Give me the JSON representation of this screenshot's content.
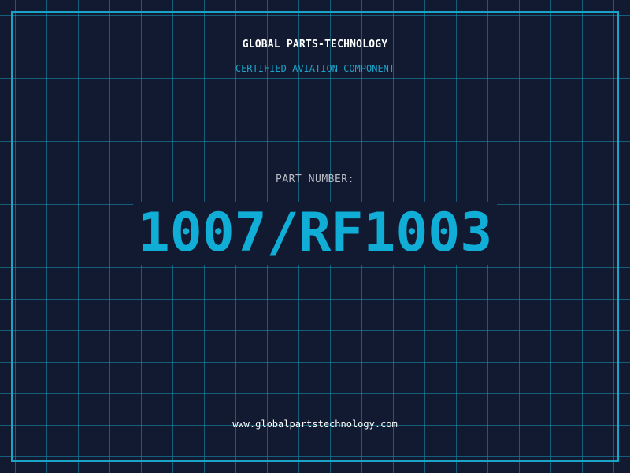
{
  "header": {
    "title": "GLOBAL PARTS-TECHNOLOGY",
    "subtitle": "CERTIFIED AVIATION COMPONENT"
  },
  "part": {
    "label": "PART NUMBER:",
    "number": "1007/RF1003"
  },
  "footer": {
    "url": "www.globalpartstechnology.com"
  },
  "colors": {
    "background": "#111a30",
    "grid": "#1496b4",
    "accent": "#10aed6",
    "text": "#ffffff",
    "muted": "#b8bcc6"
  }
}
